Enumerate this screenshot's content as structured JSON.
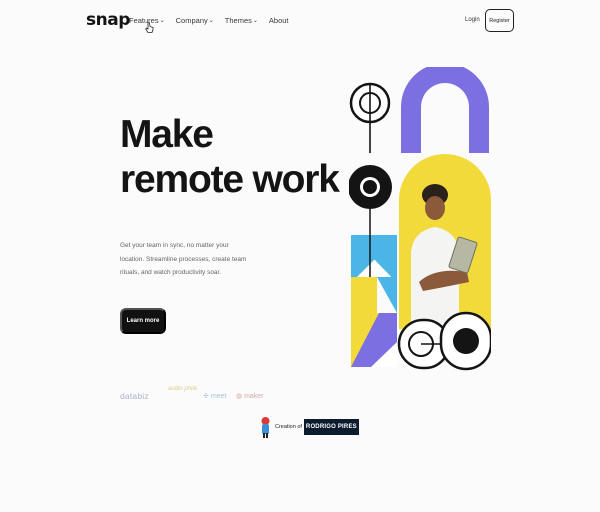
{
  "header": {
    "logo": "snap",
    "nav": [
      {
        "label": "Features",
        "has_dropdown": true
      },
      {
        "label": "Company",
        "has_dropdown": true
      },
      {
        "label": "Themes",
        "has_dropdown": true
      },
      {
        "label": "About",
        "has_dropdown": false
      }
    ],
    "login_label": "Login",
    "register_label": "Register"
  },
  "hero": {
    "title_line1": "Make",
    "title_line2": "remote work",
    "description": "Get your team in sync, no matter your location. Streamline processes, create team rituals, and watch productivity soar.",
    "cta_label": "Learn more"
  },
  "clients": [
    {
      "name": "databiz",
      "label": "databiz"
    },
    {
      "name": "audiophile",
      "label": "audio phile"
    },
    {
      "name": "meet",
      "label": "meet"
    },
    {
      "name": "maker",
      "label": "maker"
    }
  ],
  "credit": {
    "label": "Creation of",
    "name": "RODRIGO PIRES"
  },
  "colors": {
    "accent_purple": "#7a6ee0",
    "accent_yellow": "#f2dc3d",
    "accent_blue": "#49b6e6",
    "dark": "#141414"
  }
}
